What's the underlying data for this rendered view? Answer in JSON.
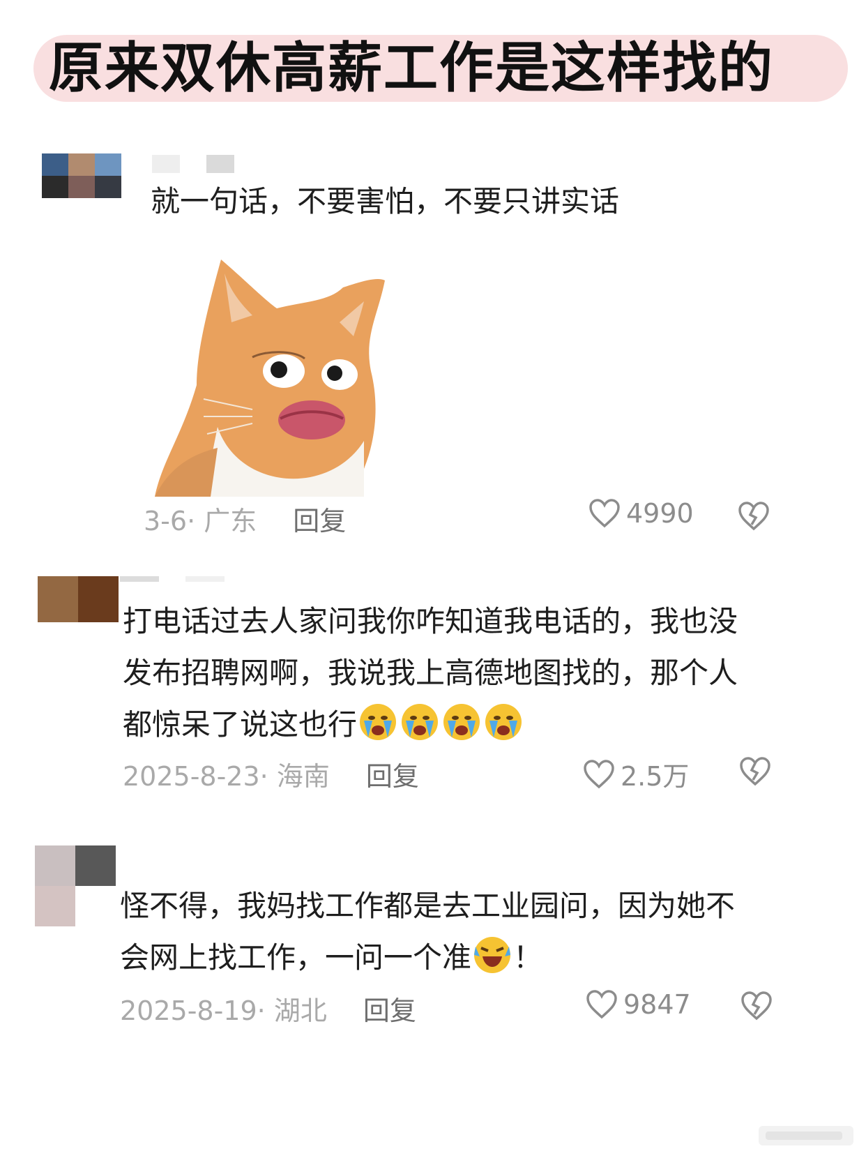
{
  "title": "原来双休高薪工作是这样找的",
  "comments": [
    {
      "text": "就一句话，不要害怕，不要只讲实话",
      "date_region": "3-6· 广东",
      "reply_label": "回复",
      "like_count": "4990",
      "avatar_colors": [
        "#3c5e88",
        "#b18b6f",
        "#6e95c0",
        "#2b2b2b",
        "#7e5e59",
        "#363a43"
      ],
      "sticker": "cat-kissy-face-sticker"
    },
    {
      "text_lines": [
        "打电话过去人家问我你咋知道我电话的，我也没",
        "发布招聘网啊，我说我上高德地图找的，那个人",
        "都惊呆了说这也行"
      ],
      "emoji": [
        "loudly-crying-face",
        "loudly-crying-face",
        "loudly-crying-face",
        "loudly-crying-face"
      ],
      "date_region": "2025-8-23· 海南",
      "reply_label": "回复",
      "like_count": "2.5万",
      "avatar_colors": [
        "#936842",
        "#6a3b1d"
      ]
    },
    {
      "text_lines": [
        "怪不得，我妈找工作都是去工业园问，因为她不",
        "会网上找工作，一问一个准",
        "！"
      ],
      "emoji": [
        "rolling-laughing-crying-face"
      ],
      "date_region": "2025-8-19· 湖北",
      "reply_label": "回复",
      "like_count": "9847",
      "avatar_colors": [
        "#c9bfc0",
        "#585858",
        "#d4c3c2",
        "#ffffff"
      ]
    }
  ],
  "icons": {
    "like": "heart-outline-icon",
    "dislike": "broken-heart-icon"
  },
  "colors": {
    "title_bg": "#f9dfe0",
    "meta_text": "#a9a9a9",
    "reply_text": "#6e6e6e",
    "icon_gray": "#8c8c8c"
  }
}
